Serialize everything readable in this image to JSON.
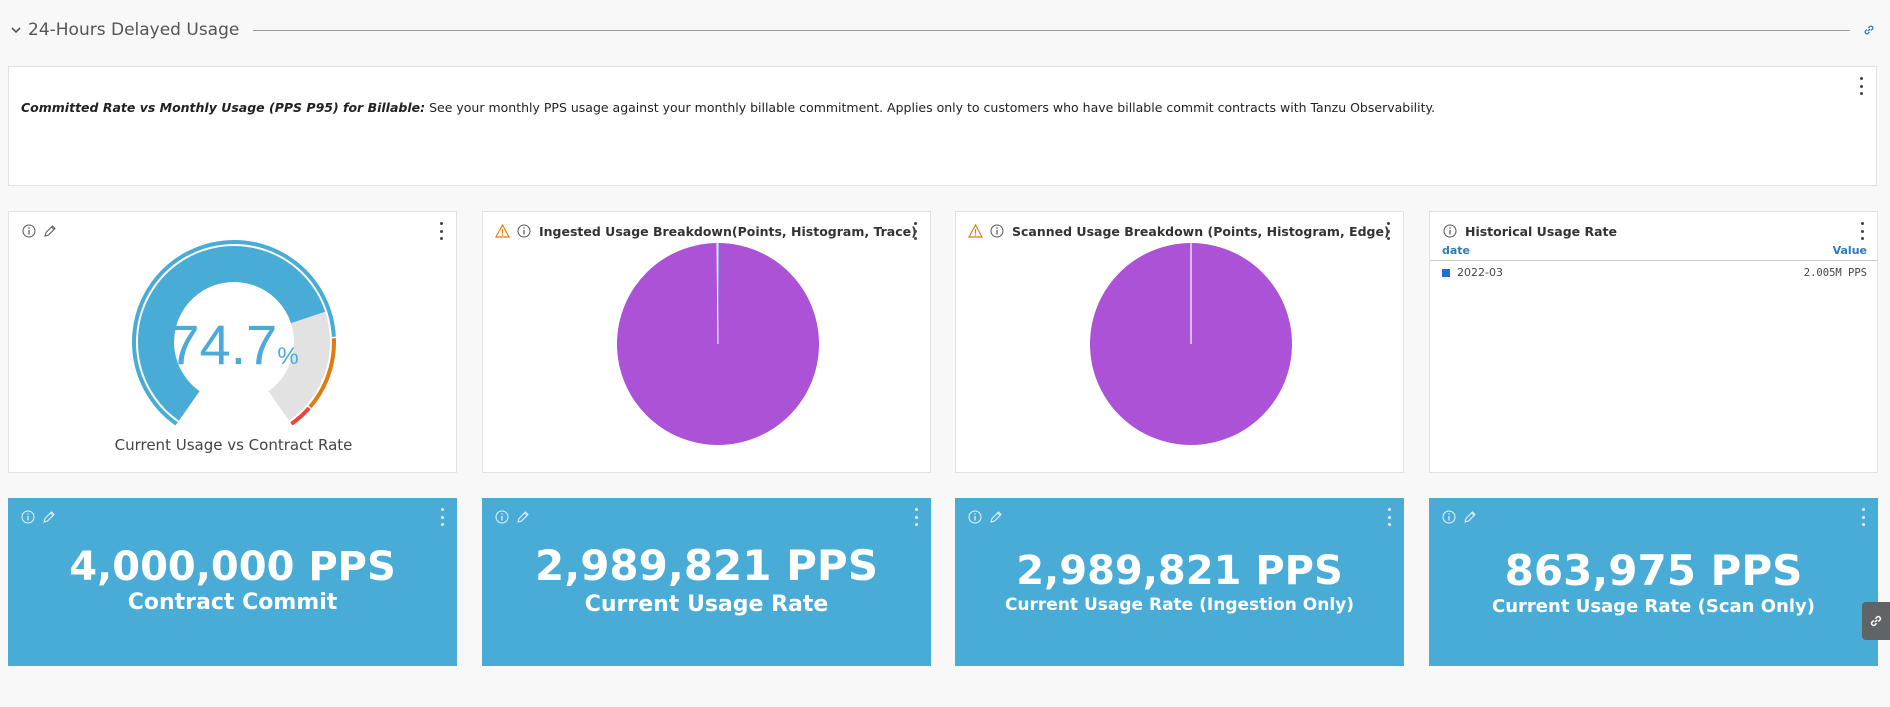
{
  "section": {
    "title": "24-Hours Delayed Usage"
  },
  "text_panel": {
    "bold_text": "Committed Rate vs Monthly Usage (PPS P95) for Billable:",
    "body_text": "See your monthly PPS usage against your monthly billable commitment. Applies only to customers who have billable commit contracts with Tanzu Observability."
  },
  "gauge": {
    "value": "74.7",
    "unit": "%",
    "label": "Current Usage vs Contract Rate",
    "fraction": 0.747
  },
  "ingested": {
    "title": "Ingested Usage Breakdown(Points, Histogram, Trace)"
  },
  "scanned": {
    "title": "Scanned Usage Breakdown (Points, Histogram, Edge)"
  },
  "history": {
    "title": "Historical Usage Rate",
    "col_date": "date",
    "col_value": "Value",
    "rows": [
      {
        "date": "2022-03",
        "value": "2.005M PPS"
      }
    ]
  },
  "stats": [
    {
      "value": "4,000,000 PPS",
      "label": "Contract Commit"
    },
    {
      "value": "2,989,821 PPS",
      "label": "Current Usage Rate"
    },
    {
      "value": "2,989,821 PPS",
      "label": "Current Usage Rate (Ingestion Only)"
    },
    {
      "value": "863,975 PPS",
      "label": "Current Usage Rate (Scan Only)"
    }
  ],
  "colors": {
    "accent": "#49acd7",
    "pie": "#ab52d6",
    "warning": "#e07b12",
    "danger": "#e8483c",
    "gauge_track": "#e2e2e2"
  },
  "icons": {
    "collapse": "chevron-down-icon",
    "link": "link-icon",
    "info": "info-icon",
    "edit": "pencil-icon",
    "warning": "warning-icon",
    "menu": "kebab-icon"
  }
}
